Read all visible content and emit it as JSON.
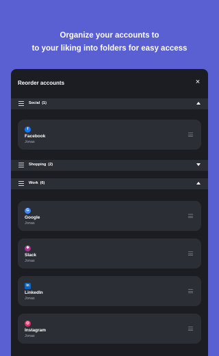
{
  "headline": {
    "line1": "Organize your accounts to",
    "line2": "to your liking into folders for easy access"
  },
  "dialog": {
    "title": "Reorder accounts",
    "close_label": "×"
  },
  "sections": [
    {
      "name": "Social",
      "count": "(1)",
      "state": "expanded"
    },
    {
      "name": "Shopping",
      "count": "(2)",
      "state": "collapsed"
    },
    {
      "name": "Work",
      "count": "(6)",
      "state": "expanded"
    }
  ],
  "accounts": [
    {
      "name": "Facebook",
      "user": "Jonas",
      "icon": "facebook-icon",
      "icon_glyph": "f",
      "color": "#1877f2"
    },
    {
      "name": "Google",
      "user": "Jonas",
      "icon": "google-icon",
      "icon_glyph": "G",
      "color": "#4285f4"
    },
    {
      "name": "Slack",
      "user": "Jonas",
      "icon": "slack-icon",
      "icon_glyph": "✱",
      "color": "#a8328f"
    },
    {
      "name": "LinkedIn",
      "user": "Jonas",
      "icon": "linkedin-icon",
      "icon_glyph": "in",
      "color": "#0a66c2"
    },
    {
      "name": "Instagram",
      "user": "Jonas",
      "icon": "instagram-icon",
      "icon_glyph": "◎",
      "color": "#e1306c"
    }
  ],
  "colors": {
    "background": "#5a5fd1",
    "panel": "#1c1d23",
    "card": "#2c2e36"
  }
}
